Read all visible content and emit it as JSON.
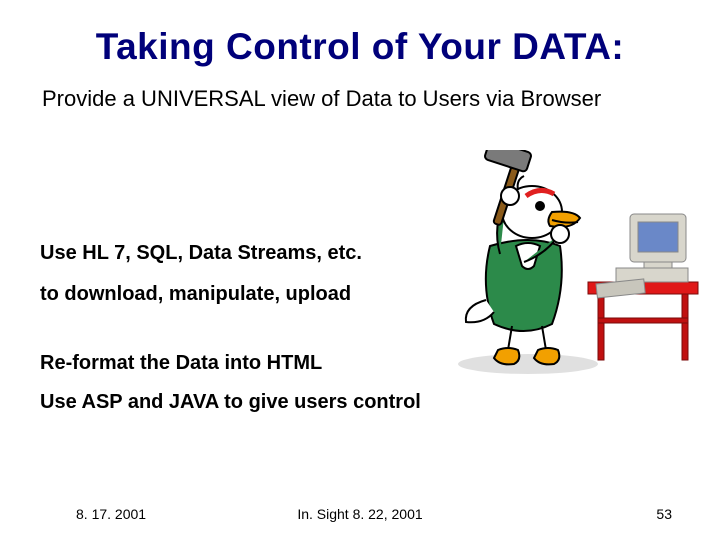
{
  "title": "Taking Control of Your DATA:",
  "subtitle": "Provide a UNIVERSAL view of Data to Users via Browser",
  "bullets": {
    "b1": "Use HL 7, SQL, Data Streams, etc.",
    "b2": "to download, manipulate, upload",
    "b3": "Re-format the Data into HTML",
    "b4": "Use ASP and JAVA to give users control"
  },
  "footer": {
    "date": "8. 17. 2001",
    "center": "In. Sight 8. 22, 2001",
    "page": "53"
  },
  "art": {
    "name": "duck-smashing-computer-clipart",
    "colors": {
      "duck_body": "#ffffff",
      "duck_outline": "#000000",
      "shirt": "#2c8a4a",
      "beak_feet": "#f2a000",
      "eyebrow": "#e02020",
      "hammer_handle": "#8a5a1a",
      "hammer_head": "#7a7a7a",
      "table_top": "#e01818",
      "table_legs": "#c01010",
      "monitor_body": "#d8d6cc",
      "monitor_screen": "#6a88c8",
      "keyboard": "#c8c6bc"
    }
  }
}
